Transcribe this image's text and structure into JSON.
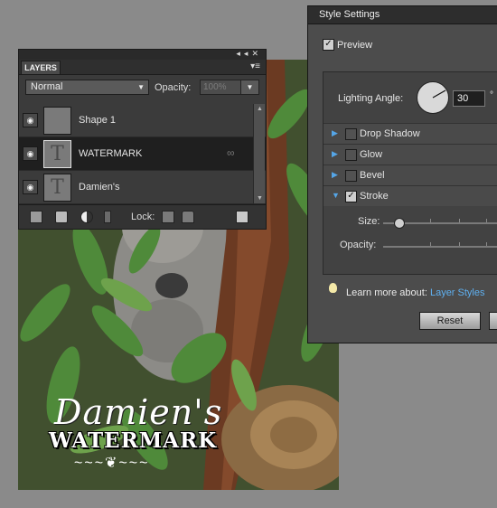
{
  "layers_panel": {
    "tab_label": "LAYERS",
    "blend_mode": "Normal",
    "opacity_label": "Opacity:",
    "opacity_value": "100%",
    "lock_label": "Lock:",
    "layers": [
      {
        "name": "Shape 1",
        "type": "shape",
        "selected": false
      },
      {
        "name": "WATERMARK",
        "type": "text",
        "selected": true
      },
      {
        "name": "Damien's",
        "type": "text",
        "selected": false
      }
    ]
  },
  "photo": {
    "watermark_script": "Damien's",
    "watermark_main": "WATERMARK",
    "watermark_flourish": "~~~❦~~~"
  },
  "style_settings": {
    "title": "Style Settings",
    "preview_label": "Preview",
    "preview_checked": true,
    "lighting_angle_label": "Lighting Angle:",
    "lighting_angle_value": "30",
    "degree_symbol": "°",
    "effects": [
      {
        "label": "Drop Shadow",
        "checked": false,
        "expanded": false
      },
      {
        "label": "Glow",
        "checked": false,
        "expanded": false
      },
      {
        "label": "Bevel",
        "checked": false,
        "expanded": false
      },
      {
        "label": "Stroke",
        "checked": true,
        "expanded": true
      }
    ],
    "size_label": "Size:",
    "opacity_label": "Opacity:",
    "learn_more_text": "Learn more about:",
    "learn_more_link": "Layer Styles",
    "reset_label": "Reset"
  },
  "colors": {
    "link": "#5fb0f0",
    "expand_triangle": "#55a6e8",
    "selected_row": "#1f1f1f"
  }
}
